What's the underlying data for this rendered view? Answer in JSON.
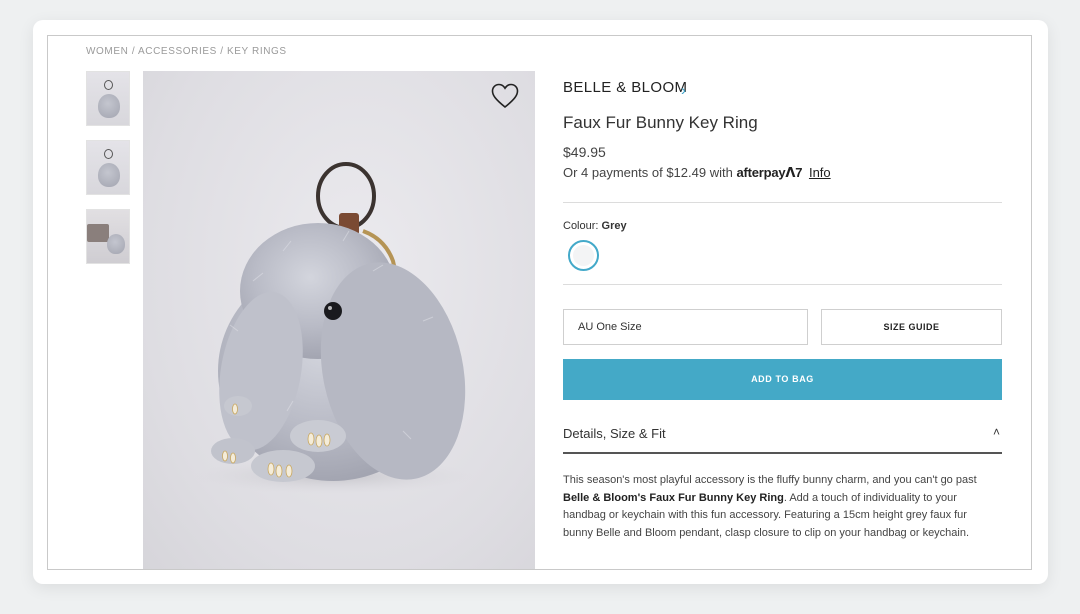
{
  "breadcrumb": "WOMEN / ACCESSORIES / KEY RINGS",
  "thumbnails": [
    {
      "alt": "Bunny key ring front"
    },
    {
      "alt": "Bunny key ring side"
    },
    {
      "alt": "Bunny key ring with handbag"
    }
  ],
  "product": {
    "brand": "BELLE & BLOOM",
    "brand_chevron": "›",
    "title": "Faux Fur Bunny Key Ring",
    "price": "$49.95",
    "afterpay_prefix": "Or 4 payments of $12.49 with",
    "afterpay_logo": "afterpay",
    "afterpay_logo_mark": "ᐱ7",
    "afterpay_info": "Info",
    "colour_label": "Colour:",
    "colour_value": "Grey",
    "size_value": "AU One Size",
    "size_guide": "SIZE GUIDE",
    "add_to_bag": "ADD TO BAG",
    "details_label": "Details, Size & Fit",
    "details_chevron": "˄",
    "description_1": "This season's most playful accessory is the fluffy bunny charm, and you can't go past ",
    "description_bold": "Belle & Bloom's Faux Fur Bunny Key Ring",
    "description_2": ". Add a touch of individuality to your handbag or keychain with this fun accessory. Featuring a 15cm height grey faux fur bunny Belle and Bloom pendant, clasp closure to clip on your handbag or keychain."
  },
  "colors": {
    "accent": "#44a9c7",
    "swatch_grey": "#f3f4f5"
  },
  "icons": {
    "wishlist": "heart-outline-icon"
  }
}
